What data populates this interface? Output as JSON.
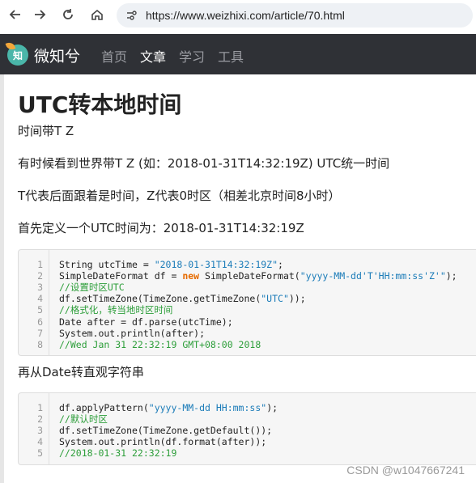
{
  "browser": {
    "url": "https://www.weizhixi.com/article/70.html"
  },
  "site": {
    "logo_char": "知",
    "brand": "微知兮",
    "nav": [
      {
        "label": "首页",
        "active": false
      },
      {
        "label": "文章",
        "active": true
      },
      {
        "label": "学习",
        "active": false
      },
      {
        "label": "工具",
        "active": false
      }
    ]
  },
  "article": {
    "title": "UTC转本地时间",
    "paragraphs": [
      "时间带T Z",
      "有时候看到世界带T Z (如：2018-01-31T14:32:19Z) UTC统一时间",
      "T代表后面跟着是时间，Z代表0时区（相差北京时间8小时）",
      "首先定义一个UTC时间为：2018-01-31T14:32:19Z"
    ],
    "between": "再从Date转直观字符串",
    "code1": [
      "String utcTime = \"2018-01-31T14:32:19Z\";",
      "SimpleDateFormat df = new SimpleDateFormat(\"yyyy-MM-dd'T'HH:mm:ss'Z'\");",
      "//设置时区UTC",
      "df.setTimeZone(TimeZone.getTimeZone(\"UTC\"));",
      "//格式化，转当地时区时间",
      "Date after = df.parse(utcTime);",
      "System.out.println(after);",
      "//Wed Jan 31 22:32:19 GMT+08:00 2018"
    ],
    "code2": [
      "df.applyPattern(\"yyyy-MM-dd HH:mm:ss\");",
      "//默认时区",
      "df.setTimeZone(TimeZone.getDefault());",
      "System.out.println(df.format(after));",
      "//2018-01-31 22:32:19"
    ]
  },
  "watermark": "CSDN @w1047667241",
  "colors": {
    "nav_bg": "#2f3136",
    "nav_active": "#ffffff",
    "nav_inactive": "#9a9ca2",
    "code_string": "#1a7bb8",
    "code_keyword": "#e66b00",
    "code_comment": "#2d9e3a"
  }
}
